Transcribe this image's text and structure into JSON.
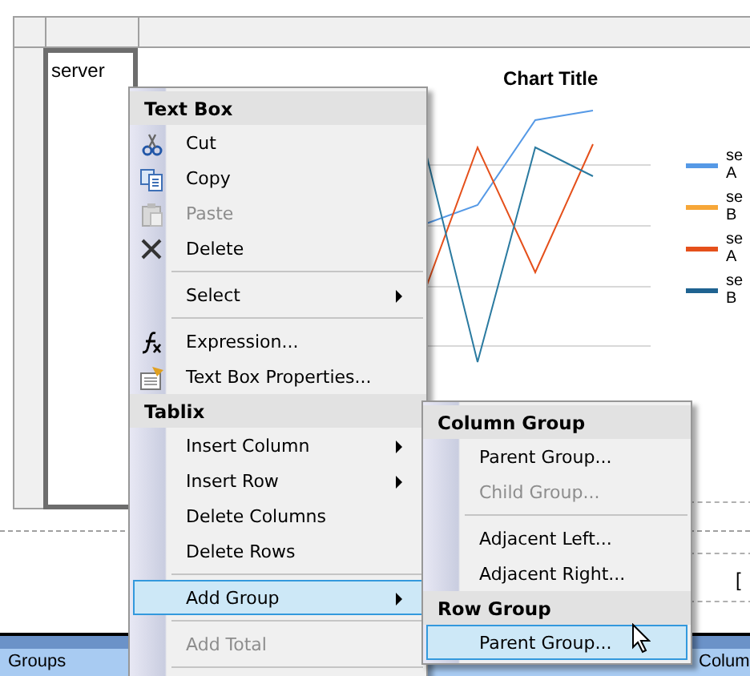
{
  "designer": {
    "textbox_value": "server",
    "fragment": "[",
    "chart": {
      "title": "Chart Title",
      "legend": [
        {
          "label": "se A",
          "color": "#5599e6"
        },
        {
          "label": "se B",
          "color": "#f7a738"
        },
        {
          "label": "se A",
          "color": "#e5501b"
        },
        {
          "label": "se B",
          "color": "#1f6391"
        }
      ]
    },
    "bottom_bar": {
      "left": "Groups",
      "right": "Colum"
    }
  },
  "context_menu": {
    "sections": [
      {
        "header": "Text Box",
        "items": [
          {
            "kind": "item",
            "label": "Cut",
            "disabled": false,
            "selected": false,
            "submenu": false
          },
          {
            "kind": "item",
            "label": "Copy",
            "disabled": false,
            "selected": false,
            "submenu": false
          },
          {
            "kind": "item",
            "label": "Paste",
            "disabled": true,
            "selected": false,
            "submenu": false
          },
          {
            "kind": "item",
            "label": "Delete",
            "disabled": false,
            "selected": false,
            "submenu": false
          },
          {
            "kind": "separator"
          },
          {
            "kind": "item",
            "label": "Select",
            "disabled": false,
            "selected": false,
            "submenu": true
          },
          {
            "kind": "separator"
          },
          {
            "kind": "item",
            "label": "Expression...",
            "disabled": false,
            "selected": false,
            "submenu": false
          },
          {
            "kind": "item",
            "label": "Text Box Properties...",
            "disabled": false,
            "selected": false,
            "submenu": false
          }
        ]
      },
      {
        "header": "Tablix",
        "items": [
          {
            "kind": "item",
            "label": "Insert Column",
            "disabled": false,
            "selected": false,
            "submenu": true
          },
          {
            "kind": "item",
            "label": "Insert Row",
            "disabled": false,
            "selected": false,
            "submenu": true
          },
          {
            "kind": "item",
            "label": "Delete Columns",
            "disabled": false,
            "selected": false,
            "submenu": false
          },
          {
            "kind": "item",
            "label": "Delete Rows",
            "disabled": false,
            "selected": false,
            "submenu": false
          },
          {
            "kind": "separator"
          },
          {
            "kind": "item",
            "label": "Add Group",
            "disabled": false,
            "selected": true,
            "submenu": true
          },
          {
            "kind": "separator"
          },
          {
            "kind": "item",
            "label": "Add Total",
            "disabled": true,
            "selected": false,
            "submenu": false
          },
          {
            "kind": "separator"
          }
        ]
      }
    ]
  },
  "submenu": {
    "sections": [
      {
        "header": "Column Group",
        "items": [
          {
            "kind": "item",
            "label": "Parent Group...",
            "disabled": false,
            "selected": false,
            "submenu": false
          },
          {
            "kind": "item",
            "label": "Child Group...",
            "disabled": true,
            "selected": false,
            "submenu": false
          },
          {
            "kind": "separator"
          },
          {
            "kind": "item",
            "label": "Adjacent Left...",
            "disabled": false,
            "selected": false,
            "submenu": false
          },
          {
            "kind": "item",
            "label": "Adjacent Right...",
            "disabled": false,
            "selected": false,
            "submenu": false
          }
        ]
      },
      {
        "header": "Row Group",
        "items": [
          {
            "kind": "item",
            "label": "Parent Group...",
            "disabled": false,
            "selected": true,
            "submenu": false
          }
        ]
      }
    ]
  }
}
